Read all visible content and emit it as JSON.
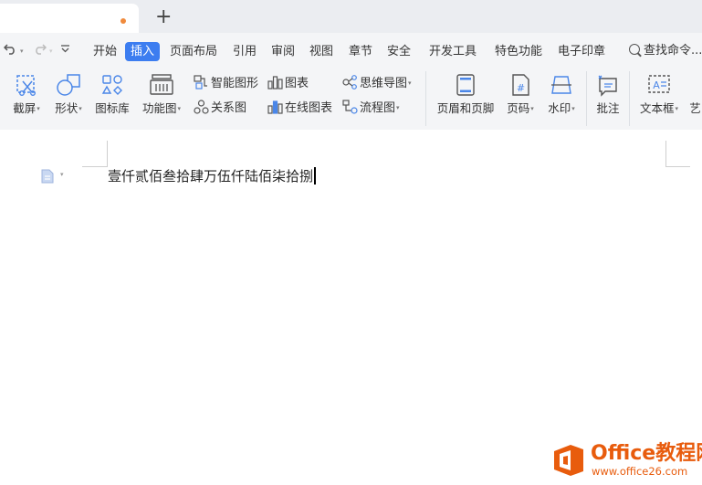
{
  "colors": {
    "accent": "#3c7df0",
    "tab_dot": "#f08a3c",
    "watermark": "#e85c0d"
  },
  "tabs": {
    "new_tab_label": "+"
  },
  "menu": {
    "undo_icon": "undo-icon",
    "redo_icon": "redo-icon",
    "customize_icon": "customize-quick-access-icon",
    "items": [
      "开始",
      "插入",
      "页面布局",
      "引用",
      "审阅",
      "视图",
      "章节",
      "安全",
      "开发工具",
      "特色功能",
      "电子印章"
    ],
    "active": "插入",
    "search_label": "查找命令..."
  },
  "toolbar": {
    "screenshot": "截屏",
    "shape": "形状",
    "icon_library": "图标库",
    "function_chart": "功能图",
    "smart_art": "智能图形",
    "chart": "图表",
    "mind_map": "思维导图",
    "relation_chart": "关系图",
    "online_chart": "在线图表",
    "flow_chart": "流程图",
    "header_footer": "页眉和页脚",
    "page_number": "页码",
    "watermark": "水印",
    "comment": "批注",
    "text_box": "文本框",
    "art_text": "艺"
  },
  "document": {
    "text": "壹仟贰佰叁拾肆万伍仟陆佰柒拾捌"
  },
  "watermark": {
    "brand": "Office教程网",
    "url": "www.office26.com"
  }
}
